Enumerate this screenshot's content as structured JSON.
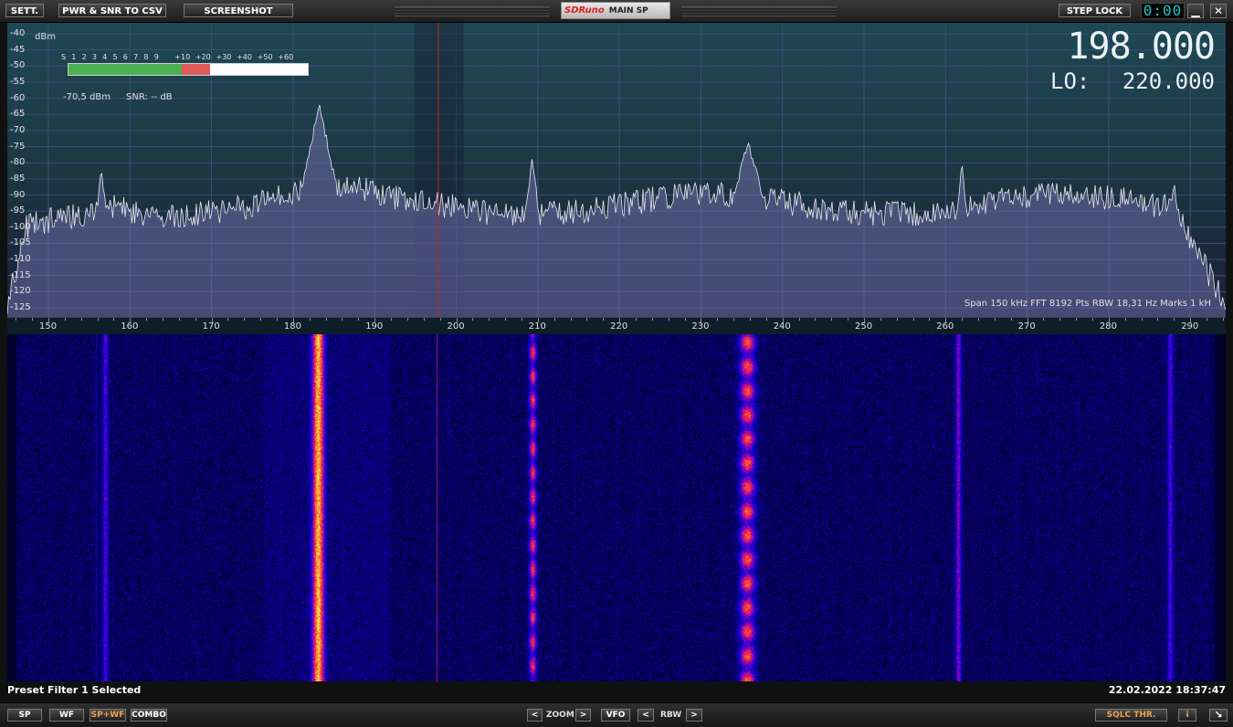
{
  "toolbar": {
    "settings_label": "SETT.",
    "csv_label": "PWR & SNR TO CSV",
    "screenshot_label": "SCREENSHOT",
    "brand": "SDRuno",
    "mode": "MAIN SP",
    "step_lock_label": "STEP LOCK",
    "clock": "0:00",
    "minimize_icon": "minimize-icon",
    "close_icon": "close-icon"
  },
  "spectrum": {
    "unit": "dBm",
    "db_ticks": [
      "-40",
      "-45",
      "-50",
      "-55",
      "-60",
      "-65",
      "-70",
      "-75",
      "-80",
      "-85",
      "-90",
      "-95",
      "-100",
      "-105",
      "-110",
      "-115",
      "-120",
      "-125"
    ],
    "freq_ticks": [
      "150",
      "160",
      "170",
      "180",
      "190",
      "200",
      "210",
      "220",
      "230",
      "240",
      "250",
      "260",
      "270",
      "280",
      "290"
    ],
    "smeter_labels": [
      "S",
      "1",
      "2",
      "3",
      "4",
      "5",
      "6",
      "7",
      "8",
      "9",
      "+10",
      "+20",
      "+30",
      "+40",
      "+50",
      "+60"
    ],
    "smeter_level_fraction": 0.59,
    "power_text": "-70,5 dBm",
    "snr_text": "SNR: -- dB",
    "frequency": "198.000",
    "lo_label": "LO:",
    "lo_value": "220.000",
    "info": "Span 150 kHz   FFT 8192 Pts   RBW 18,31 Hz   Marks 1 kH",
    "colors": {
      "trace": "#e8e8f0",
      "fill": "#6a6aa0",
      "marker": "#cc2222"
    }
  },
  "status": {
    "message": "Preset Filter 1 Selected",
    "datetime": "22.02.2022 18:37:47"
  },
  "bottom": {
    "sp_label": "SP",
    "wf_label": "WF",
    "spwf_label": "SP+WF",
    "combo_label": "COMBO",
    "zoom_prev": "<",
    "zoom_label": "ZOOM",
    "zoom_next": ">",
    "vfo_label": "VFO",
    "rbw_prev": "<",
    "rbw_label": "RBW",
    "rbw_next": ">",
    "sqlc_label": "SQLC THR.",
    "info_label": "i",
    "resize_icon": "resize-icon"
  }
}
